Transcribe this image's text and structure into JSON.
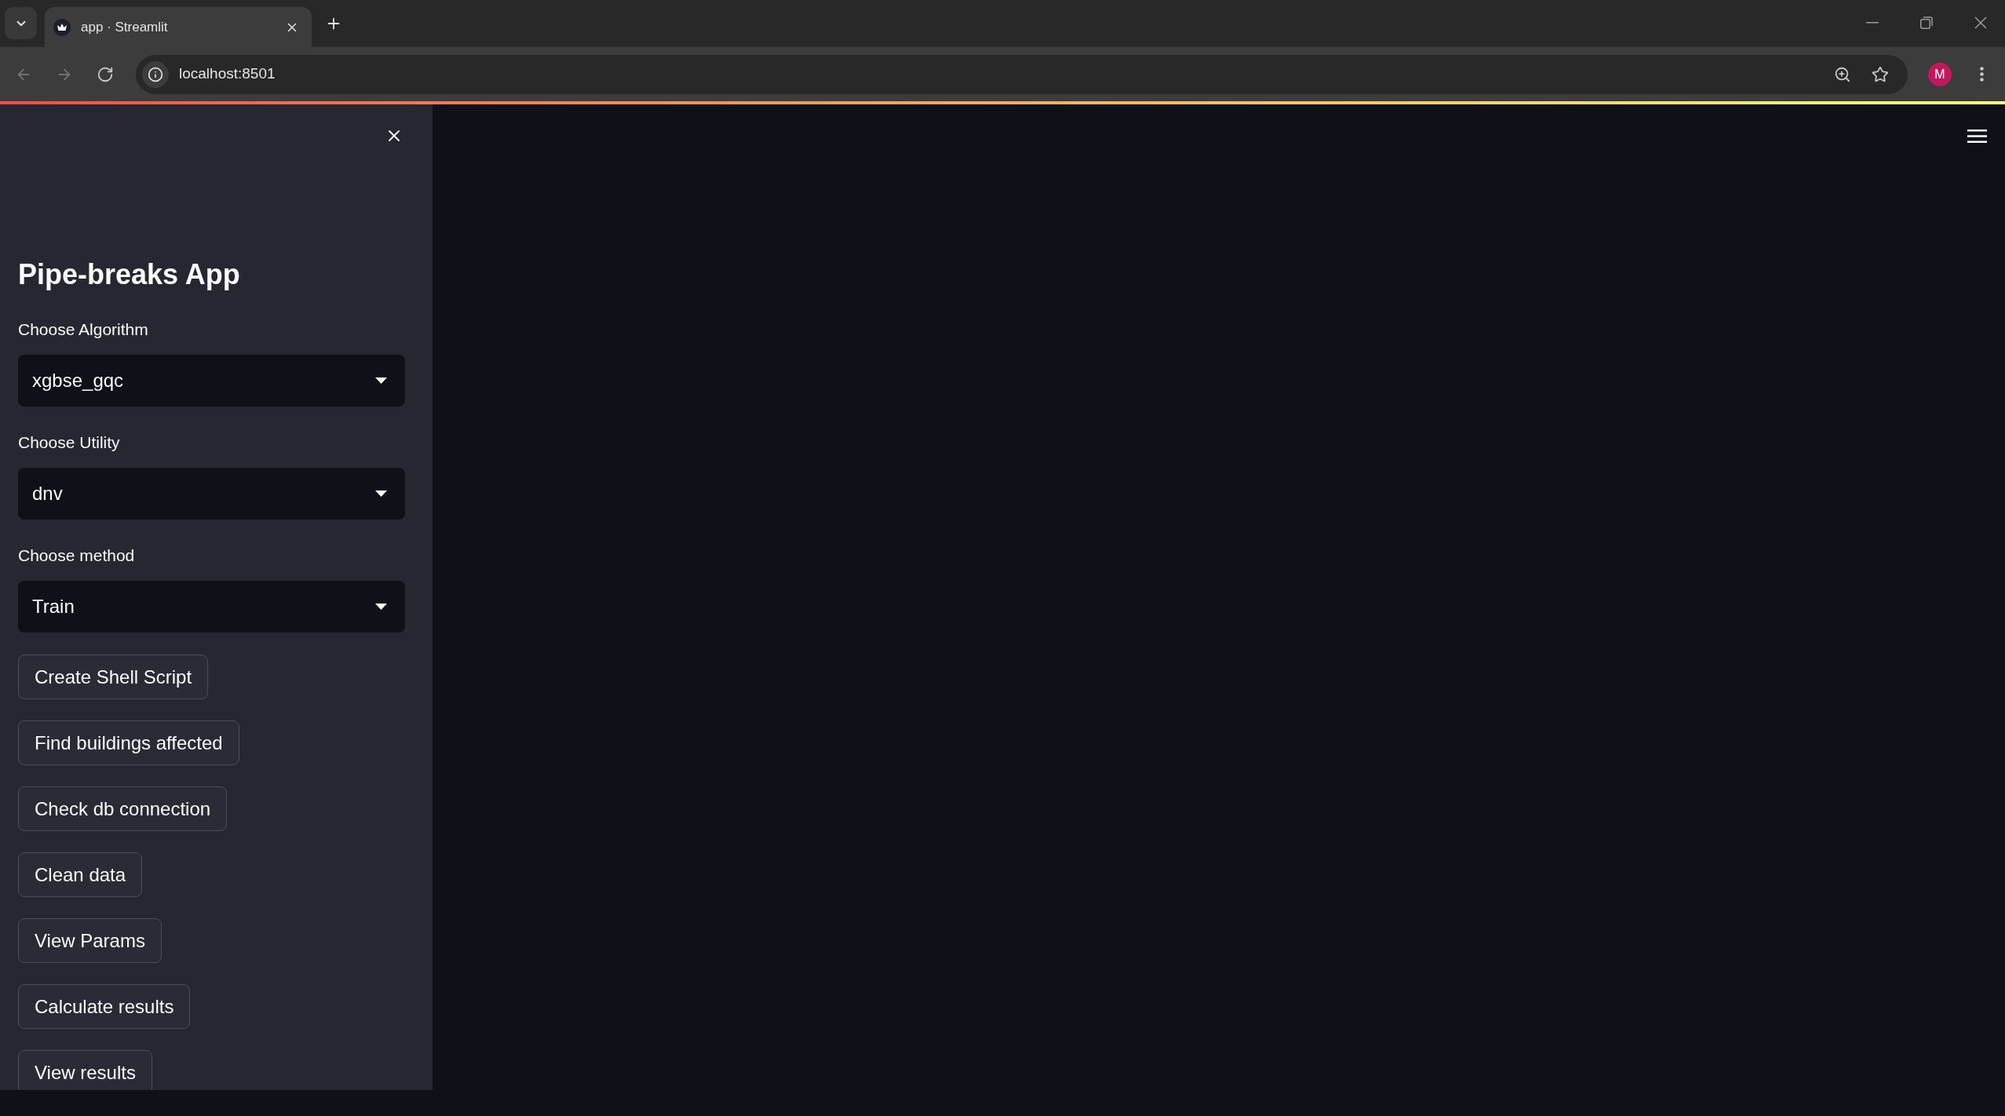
{
  "browser": {
    "tabs": [
      {
        "title": "app · Streamlit",
        "selected": true
      }
    ],
    "nav_buttons": [
      {
        "kind": "back",
        "disabled": true
      },
      {
        "kind": "forward",
        "disabled": true
      },
      {
        "kind": "reload",
        "disabled": false
      }
    ],
    "url": "localhost:8501",
    "profile_initial": "M"
  },
  "sidebar": {
    "title": "Pipe-breaks App",
    "selects": [
      {
        "label": "Choose Algorithm",
        "value": "xgbse_gqc"
      },
      {
        "label": "Choose Utility",
        "value": "dnv"
      },
      {
        "label": "Choose method",
        "value": "Train"
      }
    ],
    "buttons": [
      "Create Shell Script",
      "Find buildings affected",
      "Check db connection",
      "Clean data",
      "View Params",
      "Calculate results",
      "View results"
    ]
  }
}
